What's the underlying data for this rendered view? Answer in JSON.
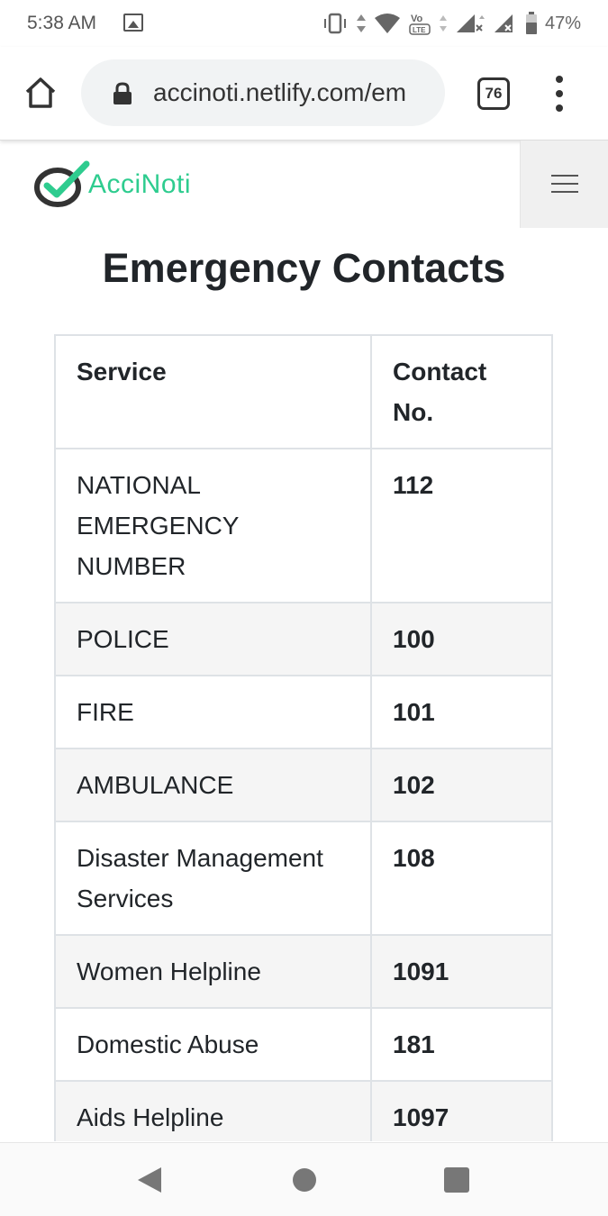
{
  "status_bar": {
    "time": "5:38 AM",
    "battery_percent": "47%",
    "icons": [
      "image-icon",
      "vibrate-icon",
      "data-arrows-icon",
      "wifi-icon",
      "volte-icon",
      "signal-icon",
      "signal-icon",
      "battery-icon"
    ]
  },
  "browser": {
    "url": "accinoti.netlify.com/em",
    "tab_count": "76"
  },
  "site": {
    "logo_text": "AcciNoti",
    "brand_color": "#2ecc8f"
  },
  "page": {
    "title": "Emergency Contacts"
  },
  "table": {
    "headers": [
      "Service",
      "Contact No."
    ],
    "rows": [
      {
        "service": "NATIONAL EMERGENCY NUMBER",
        "contact": "112"
      },
      {
        "service": "POLICE",
        "contact": "100"
      },
      {
        "service": "FIRE",
        "contact": "101"
      },
      {
        "service": "AMBULANCE",
        "contact": "102"
      },
      {
        "service": "Disaster Management Services",
        "contact": "108"
      },
      {
        "service": "Women Helpline",
        "contact": "1091"
      },
      {
        "service": "Domestic Abuse",
        "contact": "181"
      },
      {
        "service": "Aids Helpline",
        "contact": "1097"
      },
      {
        "service": "",
        "contact": ""
      }
    ]
  }
}
